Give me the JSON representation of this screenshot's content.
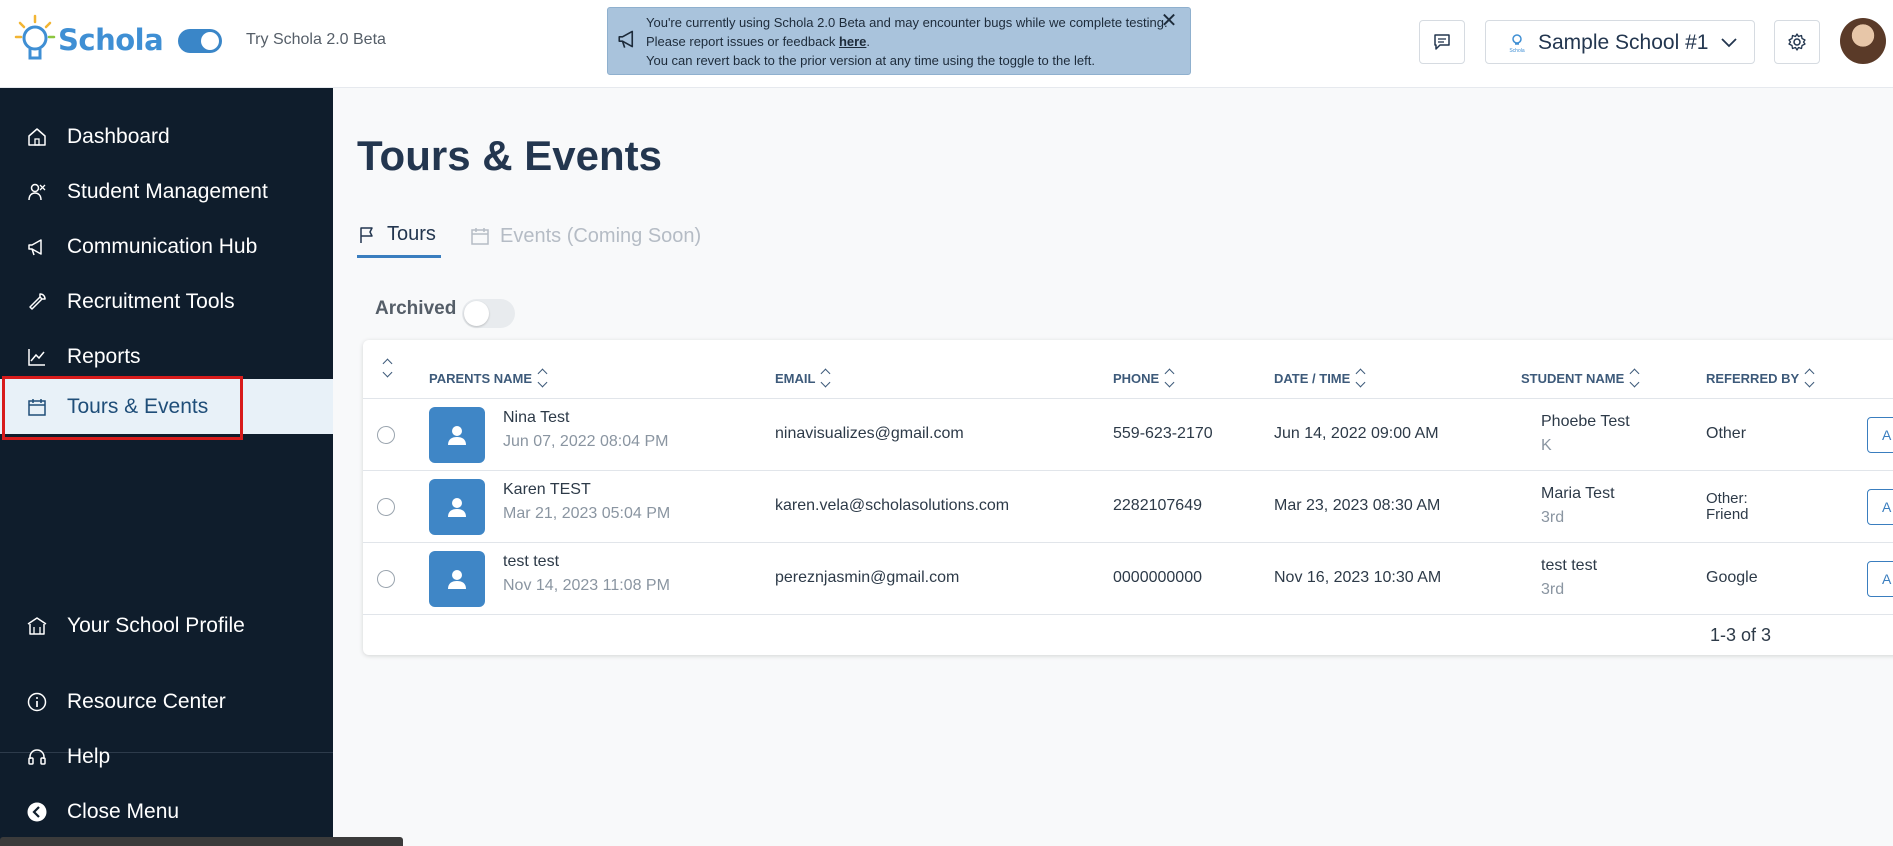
{
  "header": {
    "logo_text": "Schola",
    "beta_label": "Try Schola 2.0 Beta",
    "banner": {
      "line1": "You're currently using Schola 2.0 Beta and may encounter bugs while we complete testing.",
      "line2_prefix": "Please report issues or feedback ",
      "line2_link": "here",
      "line2_suffix": ".",
      "line3": "You can revert back to the prior version at any time using the toggle to the left."
    },
    "school_name": "Sample School #1",
    "school_logo_text": "Schola"
  },
  "sidebar": {
    "items": [
      {
        "label": "Dashboard",
        "icon": "home-icon"
      },
      {
        "label": "Student Management",
        "icon": "students-icon"
      },
      {
        "label": "Communication Hub",
        "icon": "megaphone-icon"
      },
      {
        "label": "Recruitment Tools",
        "icon": "wrench-icon"
      },
      {
        "label": "Reports",
        "icon": "chart-icon"
      },
      {
        "label": "Tours & Events",
        "icon": "calendar-icon",
        "active": true
      }
    ],
    "bottom_items": [
      {
        "label": "Your School Profile",
        "icon": "school-icon"
      },
      {
        "label": "Resource Center",
        "icon": "info-icon"
      },
      {
        "label": "Help",
        "icon": "headset-icon"
      },
      {
        "label": "Close Menu",
        "icon": "arrow-left-circle-icon"
      }
    ]
  },
  "main": {
    "title": "Tours & Events",
    "tabs": [
      {
        "label": "Tours",
        "active": true
      },
      {
        "label": "Events (Coming Soon)",
        "active": false
      }
    ],
    "archived_label": "Archived",
    "archived_on": false,
    "table": {
      "columns": [
        "PARENTS NAME",
        "EMAIL",
        "PHONE",
        "DATE / TIME",
        "STUDENT NAME",
        "REFERRED BY"
      ],
      "rows": [
        {
          "parent": "Nina Test",
          "created": "Jun 07, 2022 08:04 PM",
          "email": "ninavisualizes@gmail.com",
          "phone": "559-623-2170",
          "datetime": "Jun 14, 2022 09:00 AM",
          "student": "Phoebe Test",
          "grade": "K",
          "referred": "Other",
          "action": "A"
        },
        {
          "parent": "Karen TEST",
          "created": "Mar 21, 2023 05:04 PM",
          "email": "karen.vela@scholasolutions.com",
          "phone": "2282107649",
          "datetime": "Mar 23, 2023 08:30 AM",
          "student": "Maria Test",
          "grade": "3rd",
          "referred": "Other: Friend",
          "action": "A"
        },
        {
          "parent": "test test",
          "created": "Nov 14, 2023 11:08 PM",
          "email": "pereznjasmin@gmail.com",
          "phone": "0000000000",
          "datetime": "Nov 16, 2023 10:30 AM",
          "student": "test test",
          "grade": "3rd",
          "referred": "Google",
          "action": "A"
        }
      ],
      "pagination": "1-3 of 3"
    }
  },
  "colors": {
    "sidebar_bg": "#0f1d2c",
    "accent": "#3f86c6",
    "active_highlight": "#d81b1b"
  }
}
